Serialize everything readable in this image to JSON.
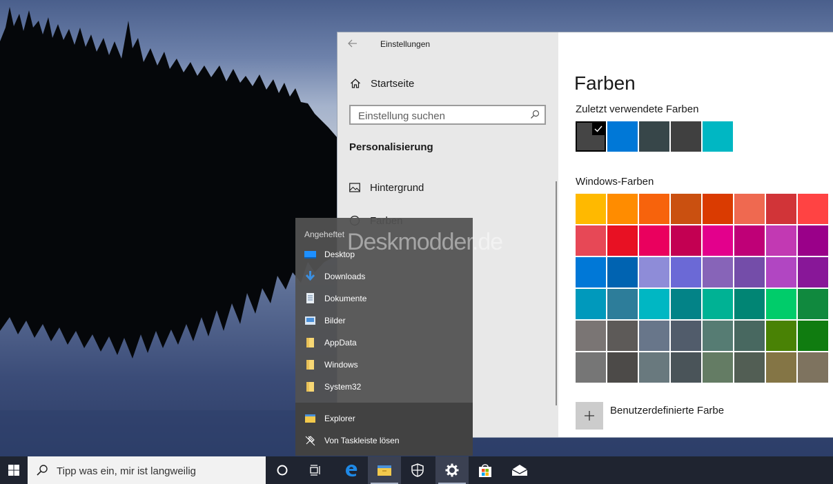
{
  "settings": {
    "window_title": "Einstellungen",
    "home_label": "Startseite",
    "search_placeholder": "Einstellung suchen",
    "section_title": "Personalisierung",
    "nav_items": [
      {
        "label": "Hintergrund",
        "icon": "picture-icon"
      },
      {
        "label": "Farben",
        "icon": "palette-icon"
      }
    ],
    "page_title": "Farben",
    "recent_colors_heading": "Zuletzt verwendete Farben",
    "recent_colors": [
      "#454545",
      "#0078d7",
      "#374649",
      "#404040",
      "#00b7c3"
    ],
    "selected_recent_index": 0,
    "windows_colors_heading": "Windows-Farben",
    "windows_colors": [
      "#ffb900",
      "#ff8c00",
      "#f7630c",
      "#ca5010",
      "#da3b01",
      "#ef6950",
      "#d13438",
      "#ff4343",
      "#e74856",
      "#e81123",
      "#ea005e",
      "#c30052",
      "#e3008c",
      "#bf0077",
      "#c239b3",
      "#9a0089",
      "#0078d7",
      "#0063b1",
      "#8e8cd8",
      "#6b69d6",
      "#8764b8",
      "#744da9",
      "#b146c2",
      "#881798",
      "#0099bc",
      "#2d7d9a",
      "#00b7c3",
      "#038387",
      "#00b294",
      "#018574",
      "#00cc6a",
      "#10893e",
      "#7a7574",
      "#5d5a58",
      "#68768a",
      "#515c6b",
      "#567c73",
      "#486860",
      "#498205",
      "#107c10",
      "#767676",
      "#4c4a48",
      "#69797e",
      "#4a5459",
      "#647c64",
      "#525e54",
      "#847545",
      "#7e735f"
    ],
    "custom_color_label": "Benutzerdefinierte Farbe"
  },
  "jumplist": {
    "header": "Angeheftet",
    "pinned": [
      {
        "label": "Desktop",
        "icon": "desktop-folder-icon"
      },
      {
        "label": "Downloads",
        "icon": "downloads-icon"
      },
      {
        "label": "Dokumente",
        "icon": "documents-icon"
      },
      {
        "label": "Bilder",
        "icon": "pictures-folder-icon"
      },
      {
        "label": "AppData",
        "icon": "folder-icon"
      },
      {
        "label": "Windows",
        "icon": "folder-icon"
      },
      {
        "label": "System32",
        "icon": "folder-icon"
      }
    ],
    "tasks": [
      {
        "label": "Explorer",
        "icon": "file-explorer-icon"
      },
      {
        "label": "Von Taskleiste lösen",
        "icon": "unpin-icon"
      }
    ]
  },
  "watermark": "Deskmodder.de",
  "taskbar": {
    "search_placeholder": "Tipp was ein, mir ist langweilig",
    "buttons": [
      "cortana-icon",
      "task-view-icon",
      "edge-icon",
      "file-explorer-icon",
      "windows-security-icon",
      "settings-gear-icon",
      "store-icon",
      "mail-icon"
    ]
  }
}
